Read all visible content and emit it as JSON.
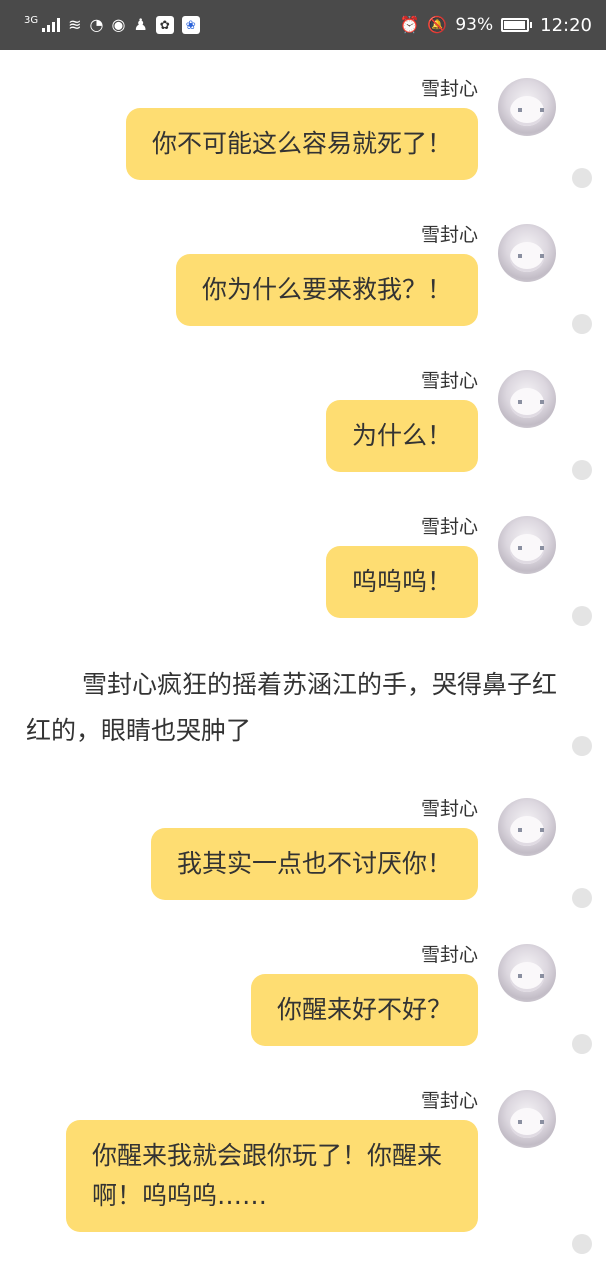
{
  "status_bar": {
    "network_label": "3G",
    "left_icons": [
      "signal-icon",
      "wifi-icon",
      "data-usage-icon",
      "eye-icon",
      "qq-icon",
      "pet-app-icon",
      "baidu-app-icon"
    ],
    "right_icons": [
      "alarm-icon",
      "mute-icon",
      "battery-icon"
    ],
    "battery_percent": "93%",
    "battery_level": 0.93,
    "time": "12:20"
  },
  "messages": [
    {
      "sender": "雪封心",
      "text": "你不可能这么容易就死了！"
    },
    {
      "sender": "雪封心",
      "text": "你为什么要来救我？！"
    },
    {
      "sender": "雪封心",
      "text": "为什么！"
    },
    {
      "sender": "雪封心",
      "text": "呜呜呜！"
    },
    {
      "sender": "雪封心",
      "text": "我其实一点也不讨厌你！"
    },
    {
      "sender": "雪封心",
      "text": "你醒来好不好？"
    },
    {
      "sender": "雪封心",
      "text": "你醒来我就会跟你玩了！你醒来啊！呜呜呜……"
    }
  ],
  "narration": "雪封心疯狂的摇着苏涵江的手，哭得鼻子红红的，眼睛也哭肿了",
  "colors": {
    "status_bar_bg": "#4a4a4a",
    "bubble_bg": "#fedd72",
    "page_bg": "#ffffff",
    "dot": "#e4e4e4"
  }
}
